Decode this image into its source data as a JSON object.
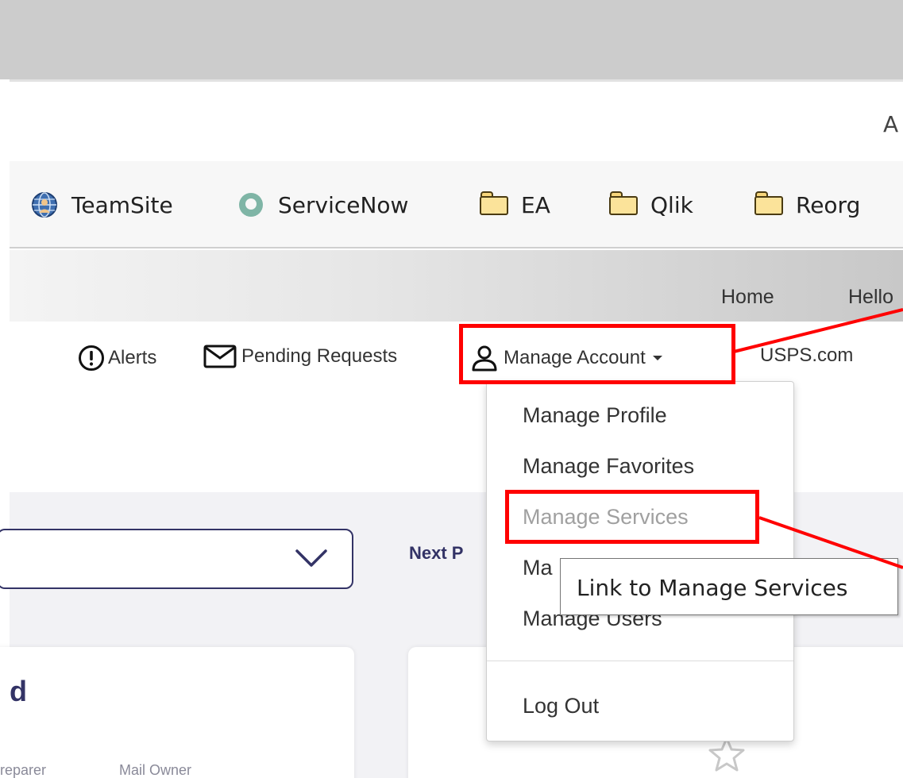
{
  "address_bar": {
    "fragment": "A"
  },
  "bookmarks": [
    {
      "label": "TeamSite",
      "icon": "globe-person-icon"
    },
    {
      "label": "ServiceNow",
      "icon": "servicenow-icon"
    },
    {
      "label": "EA",
      "icon": "folder-icon"
    },
    {
      "label": "Qlik",
      "icon": "folder-icon"
    },
    {
      "label": "Reorg",
      "icon": "folder-icon"
    }
  ],
  "header": {
    "home": "Home",
    "hello": "Hello"
  },
  "utility_nav": {
    "alerts": "Alerts",
    "pending_requests": "Pending Requests",
    "manage_account": "Manage Account",
    "usps": "USPS.com"
  },
  "dropdown": {
    "items": [
      "Manage Profile",
      "Manage Favorites",
      "Manage Services",
      "Ma",
      "Manage Users",
      "Log Out"
    ]
  },
  "tooltip": "Link to Manage Services",
  "main": {
    "next_label": "Next P",
    "card_title": "d",
    "columns": [
      "reparer",
      "Mail Owner"
    ]
  },
  "colors": {
    "brand_navy": "#333366",
    "highlight": "#ff0000",
    "disabled_text": "#a0a0a0"
  }
}
